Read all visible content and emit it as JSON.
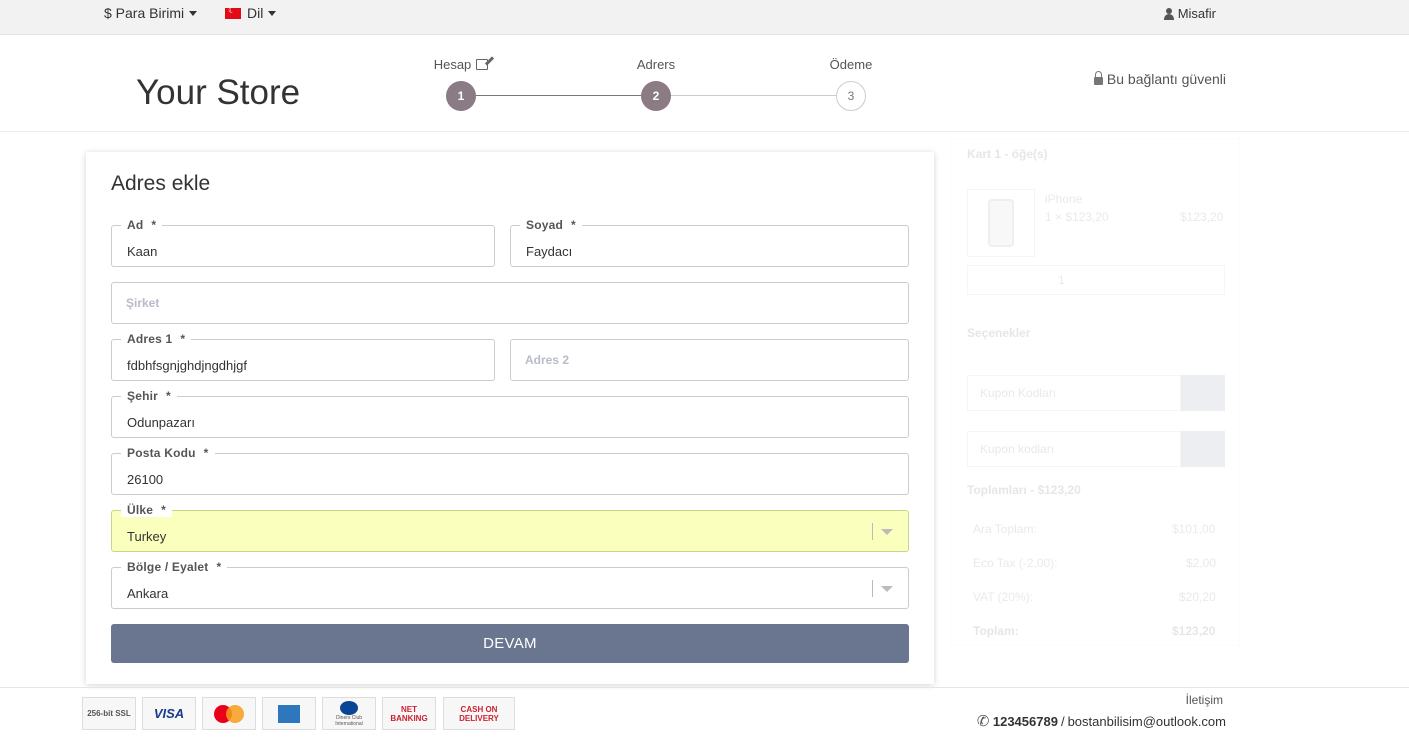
{
  "topbar": {
    "currency_label": "$ Para Birimi",
    "language_label": "Dil",
    "user_label": "Misafir"
  },
  "header": {
    "store_name": "Your Store",
    "secure_text": "Bu bağlantı güvenli",
    "steps": [
      {
        "label": "Hesap",
        "number": "1",
        "state": "done"
      },
      {
        "label": "Adrers",
        "number": "2",
        "state": "active"
      },
      {
        "label": "Ödeme",
        "number": "3",
        "state": "todo"
      }
    ]
  },
  "form": {
    "title": "Adres ekle",
    "required_mark": "*",
    "fields": {
      "first_name": {
        "label": "Ad",
        "value": "Kaan"
      },
      "last_name": {
        "label": "Soyad",
        "value": "Faydacı"
      },
      "company": {
        "placeholder": "Şirket"
      },
      "address1": {
        "label": "Adres 1",
        "value": "fdbhfsgnjghdjngdhjgf"
      },
      "address2": {
        "placeholder": "Adres 2"
      },
      "city": {
        "label": "Şehir",
        "value": "Odunpazarı"
      },
      "postcode": {
        "label": "Posta Kodu",
        "value": "26100"
      },
      "country": {
        "label": "Ülke",
        "value": "Turkey"
      },
      "region": {
        "label": "Bölge / Eyalet",
        "value": "Ankara"
      }
    },
    "continue_label": "DEVAM"
  },
  "cart": {
    "title": "Kart 1 - öğe(s)",
    "item_name": "iPhone",
    "item_qty_price": "1 × $123,20",
    "item_total": "$123,20",
    "quantity": "1",
    "options_title": "Seçenekler",
    "coupon_placeholder": "Kupon Kodları",
    "voucher_placeholder": "Kupon kodları",
    "totals_title": "Toplamları - $123,20",
    "totals": [
      {
        "label": "Ara Toplam:",
        "value": "$101,00"
      },
      {
        "label": "Eco Tax (-2,00):",
        "value": "$2,00"
      },
      {
        "label": "VAT (20%):",
        "value": "$20,20"
      },
      {
        "label": "Toplam:",
        "value": "$123,20"
      }
    ]
  },
  "footer": {
    "payment_icons": [
      {
        "name": "ssl-badge",
        "text": "256-bit SSL"
      },
      {
        "name": "visa-badge",
        "text": "VISA"
      },
      {
        "name": "mastercard-badge",
        "text": ""
      },
      {
        "name": "amex-badge",
        "text": ""
      },
      {
        "name": "diners-badge",
        "text": "Diners Club International"
      },
      {
        "name": "netbanking-badge",
        "text": "NET BANKING"
      },
      {
        "name": "cod-badge",
        "text": "CASH ON DELIVERY"
      }
    ],
    "contact_link": "İletişim",
    "phone": "123456789",
    "email": "bostanbilisim@outlook.com",
    "separator": "/"
  }
}
